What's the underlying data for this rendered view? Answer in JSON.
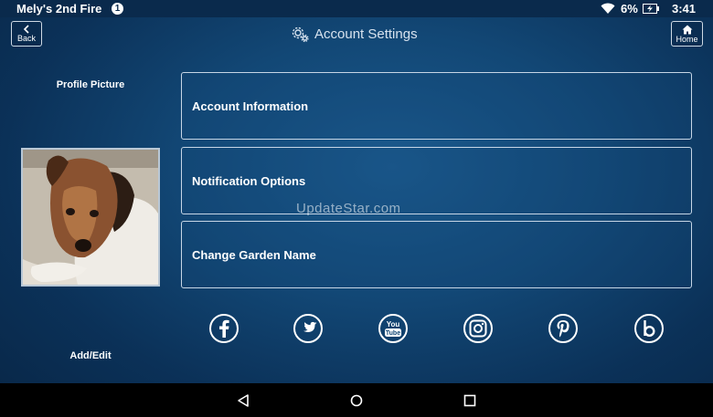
{
  "status_bar": {
    "device_name": "Mely's 2nd Fire",
    "notification_count": "1",
    "battery_percent": "6%",
    "time": "3:41",
    "icons": [
      "wifi-icon",
      "battery-charging-icon"
    ]
  },
  "header": {
    "title": "Account Settings",
    "title_icon": "gear-icon",
    "back_label": "Back",
    "home_label": "Home"
  },
  "profile": {
    "label": "Profile Picture",
    "add_edit_label": "Add/Edit"
  },
  "menu": {
    "items": [
      {
        "label": "Account Information"
      },
      {
        "label": "Notification Options"
      },
      {
        "label": "Change Garden Name"
      }
    ]
  },
  "social": [
    "facebook-icon",
    "twitter-icon",
    "youtube-icon",
    "instagram-icon",
    "pinterest-icon",
    "blog-icon"
  ],
  "watermark": "UpdateStar.com",
  "colors": {
    "background": "#124775",
    "status_bar": "#0a2a4c",
    "border": "#c7d6e6"
  }
}
